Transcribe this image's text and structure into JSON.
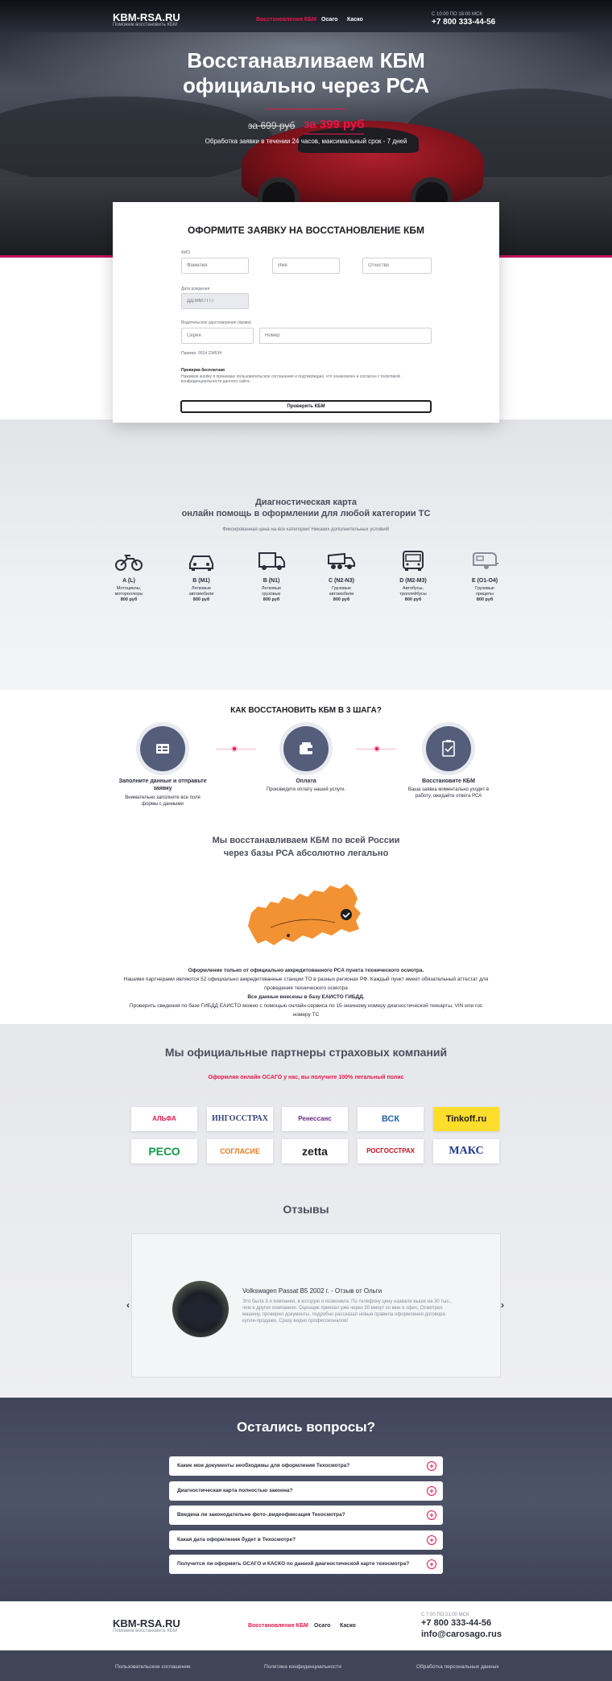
{
  "header": {
    "logo": "KBM-RSA.RU",
    "logo_sub": "Поможем восстановить КБМ",
    "nav": [
      "Восстановления КБМ",
      "Осаго",
      "Каско"
    ],
    "hours": "С 10:00 ПО 18:00 МСК",
    "phone": "+7 800 333-44-56"
  },
  "hero": {
    "title_line1": "Восстанавливаем КБМ",
    "title_line2": "официально через РСА",
    "price_old": "за 699 руб",
    "price_new": "за 399 руб",
    "subtitle": "Обработка заявки в течении 24 часов, максимальный срок - 7 дней"
  },
  "form": {
    "title": "ОФОРМИТЕ ЗАЯВКУ НА ВОССТАНОВЛЕНИЕ КБМ",
    "fio_label": "ФИО",
    "surname_placeholder": "Фамилия",
    "name_placeholder": "Имя",
    "patronymic_placeholder": "Отчество",
    "birth_label": "Дата рождения",
    "birth_placeholder": "ДД.ММ.ГГГГ",
    "license_label": "Водительское удостоверение (права)",
    "series_placeholder": "Серия",
    "number_placeholder": "Номер",
    "example": "Пример: 9914 234534",
    "note_title": "Проверка бесплатная",
    "note_text": "Нажимая кнопку я принимаю пользовательское соглашение и подтверждаю, что ознакомлен и согласен с политикой конфиденциальности данного сайта.",
    "submit": "Проверить КБМ"
  },
  "diagnostic": {
    "title_line1": "Диагностическая карта",
    "title_line2": "онлайн помощь в оформлении для любой категории ТС",
    "subtitle": "Фиксированная цена на все категории! Никаких дополнительных условий!",
    "categories": [
      {
        "name": "A (L)",
        "desc1": "Мотоциклы,",
        "desc2": "мотороллеры",
        "price": "800 руб",
        "icon": "motorcycle-icon"
      },
      {
        "name": "B (M1)",
        "desc1": "Легковые",
        "desc2": "автомобили",
        "price": "800 руб",
        "icon": "car-icon"
      },
      {
        "name": "B (N1)",
        "desc1": "Легковые",
        "desc2": "грузовые",
        "price": "800 руб",
        "icon": "van-icon"
      },
      {
        "name": "C (N2-N3)",
        "desc1": "Грузовые",
        "desc2": "автомобили",
        "price": "800 руб",
        "icon": "dump-truck-icon"
      },
      {
        "name": "D (M2-M3)",
        "desc1": "Автобусы,",
        "desc2": "троллейбусы",
        "price": "800 руб",
        "icon": "bus-icon"
      },
      {
        "name": "E (O1-O4)",
        "desc1": "Грузовые",
        "desc2": "прицепы",
        "price": "800 руб",
        "icon": "trailer-icon"
      }
    ]
  },
  "steps": {
    "title": "КАК ВОССТАНОВИТЬ КБМ В 3 ШАГА?",
    "items": [
      {
        "title1": "Заполните данные и отправьте",
        "title2": "заявку",
        "desc1": "Внимательно заполните все поля",
        "desc2": "формы с данными"
      },
      {
        "title1": "Оплата",
        "title2": "",
        "desc1": "Произведите оплату нашей услуги.",
        "desc2": ""
      },
      {
        "title1": "Восстановите КБМ",
        "title2": "",
        "desc1": "Ваша заявка моментально уходит в",
        "desc2": "работу, ожидайте ответа РСА"
      }
    ]
  },
  "russia": {
    "title_line1": "Мы восстанавливаем КБМ по всей России",
    "title_line2": "через базы РСА абсолютно легально",
    "bold1": "Оформление только от официально аккредитованного РСА пункта технического осмотра.",
    "text1a": "Нашими партнерами являются 52 официально аккредитованные станции ТО в разных регионах РФ. Каждый пункт имеет обязательный аттестат для",
    "text1b": "проведения технического осмотра",
    "bold2": "Все данные внесены в базу ЕАИСТО ГИБДД.",
    "text2a": "Проверить сведения по базе ГИБДД ЕАИСТО можно с помощью онлайн-сервиса по 15-значному номеру диагностической техкарты, VIN или гос",
    "text2b": "номеру ТС"
  },
  "partners": {
    "title": "Мы официальные партнеры страховых компаний",
    "subtitle": "Оформляя онлайн ОСАГО у нас, вы получите 100% легальный полис",
    "logos": [
      "АЛЬФА СТРАХОВАНИЕ",
      "ИНГОССТРАХ",
      "Ренессанс страхование",
      "ВСК",
      "Tinkoff.ru",
      "РЕСО",
      "СОГЛАСИЕ",
      "zetta",
      "РОСГОССТРАХ",
      "МАКС"
    ]
  },
  "reviews": {
    "title": "Отзывы",
    "heading": "Volkswagen Passat B5 2002 г. - Отзыв от Ольги",
    "text": "Это была 3-я компания, в которую я позвонила. По телефону цену назвали выше на 30 тыс., чем в других компаниях. Оценщик приехал уже через 30 минут ко мне в офис. Осмотрел машину, проверил документы, подробно рассказал новые правила оформления договора купли-продажи. Сразу видно профессионалов!",
    "prev": "‹",
    "next": "›"
  },
  "faq": {
    "title": "Остались вопросы?",
    "items": [
      "Какие мои документы необходимы для оформления Техосмотра?",
      "Диагностическая карта полностью законна?",
      "Введена ли законодательно фото-,видеофиксация Техосмотра?",
      "Какая дата оформления будет в Техосмотре?",
      "Получится ли оформить ОСАГО и КАСКО по данной диагностической карте техосмотра?"
    ]
  },
  "footer": {
    "logo": "KBM-RSA.RU",
    "logo_sub": "Поможем восстановить КБМ",
    "nav": [
      "Восстановление КБМ",
      "Осаго",
      "Каско"
    ],
    "hours": "С 7:00 ПО 21:00 МСК",
    "phone": "+7 800 333-44-56",
    "email": "info@carosago.rus",
    "links": [
      "Пользовательское соглашение",
      "Политика конфиденциальности",
      "Обработка персональных данных"
    ]
  },
  "colors": {
    "accent": "#e5174d",
    "dark": "#3f4456"
  }
}
